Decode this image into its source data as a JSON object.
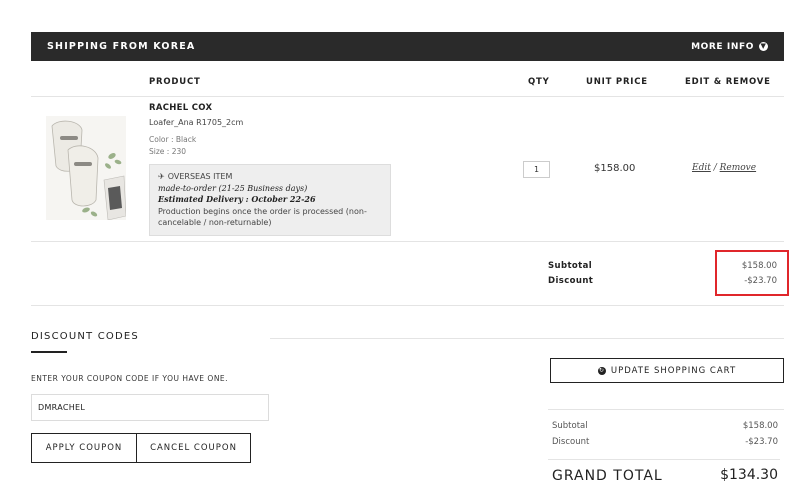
{
  "header": {
    "title": "SHIPPING FROM KOREA",
    "more_info": "MORE INFO"
  },
  "columns": {
    "product": "PRODUCT",
    "qty": "QTY",
    "unit_price": "UNIT PRICE",
    "edit_remove": "EDIT & REMOVE"
  },
  "item": {
    "name": "RACHEL COX",
    "variant": "Loafer_Ana R1705_2cm",
    "color": "Color : Black",
    "size": "Size : 230",
    "overseas_title": "OVERSEAS ITEM",
    "made_to_order": "made-to-order (21-25 Business days)",
    "estimated_delivery": "Estimated Delivery : October 22-26",
    "production_note": "Production begins once the order is processed (non-cancelable / non-returnable)",
    "qty": "1",
    "unit_price": "$158.00",
    "edit_label": "Edit",
    "separator": "/",
    "remove_label": "Remove"
  },
  "row_summary": {
    "subtotal_label": "Subtotal",
    "subtotal_value": "$158.00",
    "discount_label": "Discount",
    "discount_value": "-$23.70"
  },
  "discount_codes": {
    "title": "DISCOUNT CODES",
    "help": "ENTER YOUR COUPON CODE IF YOU HAVE ONE.",
    "code_value": "DMRACHEL",
    "apply_label": "APPLY COUPON",
    "cancel_label": "CANCEL COUPON"
  },
  "cart": {
    "update_label": "UPDATE SHOPPING CART",
    "subtotal_label": "Subtotal",
    "subtotal_value": "$158.00",
    "discount_label": "Discount",
    "discount_value": "-$23.70",
    "grand_total_label": "GRAND TOTAL",
    "grand_total_value": "$134.30"
  },
  "colors": {
    "header_bg": "#2a2a2a",
    "highlight": "#e0262b"
  }
}
